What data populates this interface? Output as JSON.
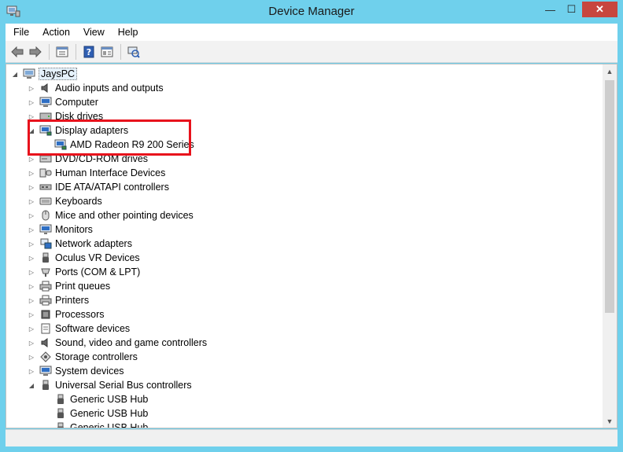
{
  "window": {
    "title": "Device Manager",
    "min_glyph": "—",
    "max_glyph": "☐",
    "close_glyph": "✕"
  },
  "menu": [
    "File",
    "Action",
    "View",
    "Help"
  ],
  "toolbar": {
    "icons": [
      "back-arrow-icon",
      "forward-arrow-icon",
      "device-view-icon",
      "help-icon",
      "properties-icon",
      "scan-hardware-icon"
    ]
  },
  "tree": {
    "root": "JaysPC",
    "categories": [
      {
        "label": "Audio inputs and outputs",
        "icon": "speaker-icon",
        "expanded": false
      },
      {
        "label": "Computer",
        "icon": "computer-icon",
        "expanded": false
      },
      {
        "label": "Disk drives",
        "icon": "disk-drive-icon",
        "expanded": false
      },
      {
        "label": "Display adapters",
        "icon": "display-adapter-icon",
        "expanded": true,
        "children": [
          "AMD Radeon R9 200 Series"
        ]
      },
      {
        "label": "DVD/CD-ROM drives",
        "icon": "dvd-drive-icon",
        "expanded": false
      },
      {
        "label": "Human Interface Devices",
        "icon": "hid-icon",
        "expanded": false
      },
      {
        "label": "IDE ATA/ATAPI controllers",
        "icon": "ide-controller-icon",
        "expanded": false
      },
      {
        "label": "Keyboards",
        "icon": "keyboard-icon",
        "expanded": false
      },
      {
        "label": "Mice and other pointing devices",
        "icon": "mouse-icon",
        "expanded": false
      },
      {
        "label": "Monitors",
        "icon": "monitor-icon",
        "expanded": false
      },
      {
        "label": "Network adapters",
        "icon": "network-adapter-icon",
        "expanded": false
      },
      {
        "label": "Oculus VR Devices",
        "icon": "usb-device-icon",
        "expanded": false
      },
      {
        "label": "Ports (COM & LPT)",
        "icon": "port-icon",
        "expanded": false
      },
      {
        "label": "Print queues",
        "icon": "printer-icon",
        "expanded": false
      },
      {
        "label": "Printers",
        "icon": "printer-icon",
        "expanded": false
      },
      {
        "label": "Processors",
        "icon": "processor-icon",
        "expanded": false
      },
      {
        "label": "Software devices",
        "icon": "software-device-icon",
        "expanded": false
      },
      {
        "label": "Sound, video and game controllers",
        "icon": "speaker-icon",
        "expanded": false
      },
      {
        "label": "Storage controllers",
        "icon": "storage-controller-icon",
        "expanded": false
      },
      {
        "label": "System devices",
        "icon": "system-device-icon",
        "expanded": false
      },
      {
        "label": "Universal Serial Bus controllers",
        "icon": "usb-icon",
        "expanded": true,
        "children": [
          "Generic USB Hub",
          "Generic USB Hub",
          "Generic USB Hub"
        ]
      }
    ]
  },
  "colors": {
    "highlight_border": "#e8121c",
    "titlebar": "#6fd0ec",
    "close_button": "#c7463e"
  }
}
